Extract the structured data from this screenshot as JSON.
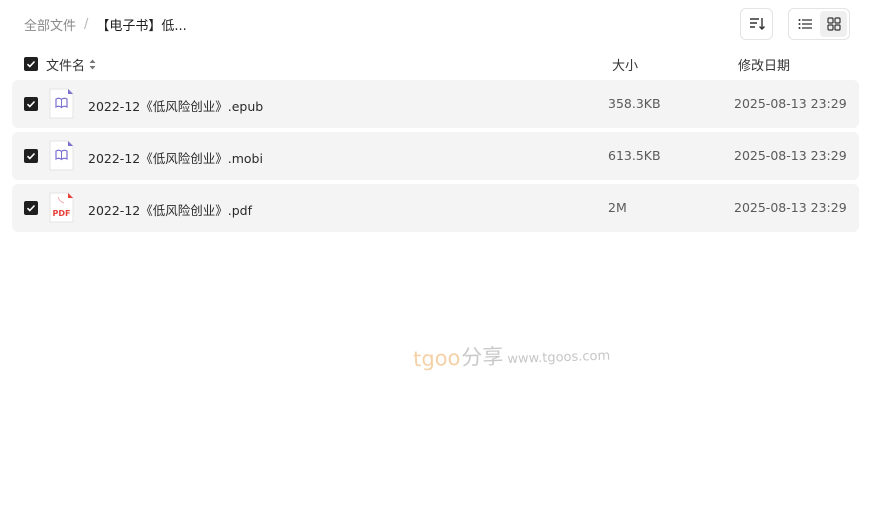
{
  "breadcrumb": {
    "root": "全部文件",
    "separator": "/",
    "current": "【电子书】低..."
  },
  "toolbar": {
    "sort_icon": "sort-icon",
    "list_view_icon": "list-view-icon",
    "grid_view_icon": "grid-view-icon"
  },
  "table": {
    "headers": {
      "name": "文件名",
      "size": "大小",
      "date": "修改日期"
    },
    "rows": [
      {
        "name": "2022-12《低风险创业》.epub",
        "size": "358.3KB",
        "date": "2025-08-13 23:29",
        "icon": "ebook-icon",
        "checked": true
      },
      {
        "name": "2022-12《低风险创业》.mobi",
        "size": "613.5KB",
        "date": "2025-08-13 23:29",
        "icon": "ebook-icon",
        "checked": true
      },
      {
        "name": "2022-12《低风险创业》.pdf",
        "size": "2M",
        "date": "2025-08-13 23:29",
        "icon": "pdf-icon",
        "checked": true
      }
    ]
  },
  "pdf_icon_label": "PDF",
  "watermark": {
    "brand": "tgoo",
    "share": "分享",
    "url": "www.tgoos.com"
  },
  "colors": {
    "accent_checkbox": "#1f1f1f",
    "row_bg": "#f4f4f4",
    "ebook_icon": "#7b6fd0",
    "pdf_icon": "#e8423c",
    "watermark_brand": "#f2c28a"
  }
}
